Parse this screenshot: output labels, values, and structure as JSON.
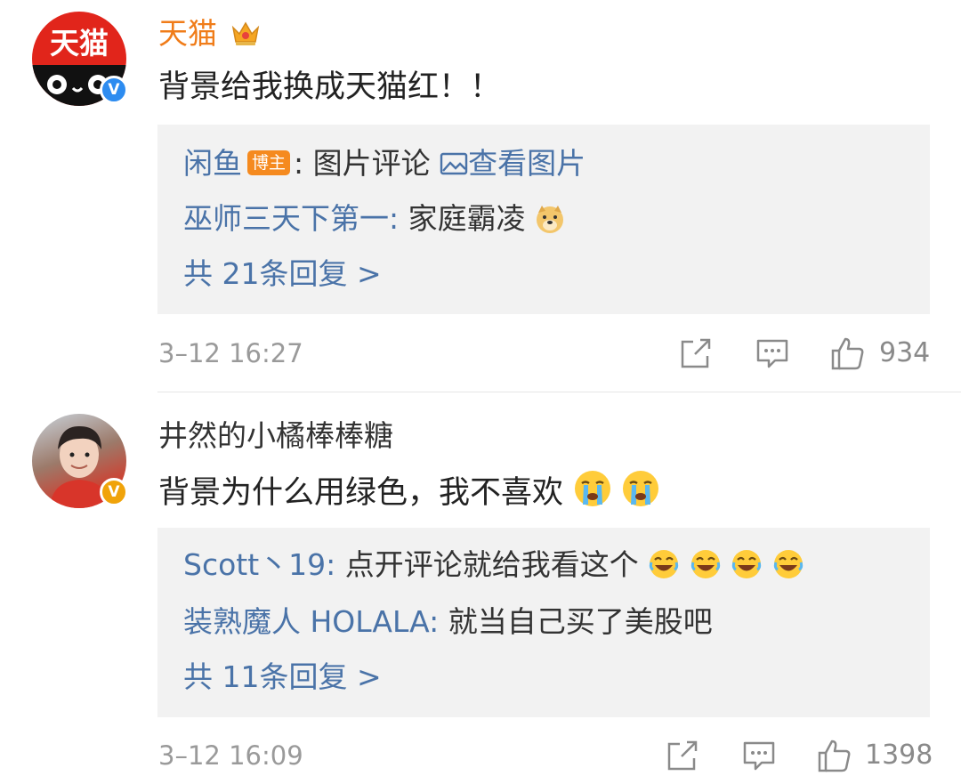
{
  "comments": [
    {
      "user": "天猫",
      "avatar_text": "天猫",
      "text": "背景给我换成天猫红！！",
      "replies": [
        {
          "user": "闲鱼",
          "badge": "博主",
          "sep": ":",
          "text": "图片评论",
          "link": "查看图片"
        },
        {
          "user": "巫师三天下第一:",
          "text": "家庭霸凌"
        }
      ],
      "reply_count": "共 21条回复 >",
      "time": "3–12 16:27",
      "likes": "934"
    },
    {
      "user": "井然的小橘棒棒糖",
      "text": "背景为什么用绿色，我不喜欢",
      "replies": [
        {
          "user": "Scott丶19:",
          "text": "点开评论就给我看这个"
        },
        {
          "user": "装熟魔人 HOLALA:",
          "text": "就当自己买了美股吧"
        }
      ],
      "reply_count": "共 11条回复 >",
      "time": "3–12 16:09",
      "likes": "1398"
    }
  ],
  "icons": {
    "crown": "crown-icon",
    "verified": "verified-icon",
    "image": "image-icon",
    "share": "share-icon",
    "comment": "comment-icon",
    "like": "like-icon",
    "doge": "doge-emoji",
    "cry": "crying-emoji",
    "laugh": "laugh-cry-emoji"
  },
  "colors": {
    "link": "#4a73a8",
    "tmall_red": "#e1251b",
    "tmall_name": "#f07c19",
    "badge": "#f58a1f",
    "verified_blue": "#2d8cf0",
    "verified_gold": "#f0a30a"
  }
}
